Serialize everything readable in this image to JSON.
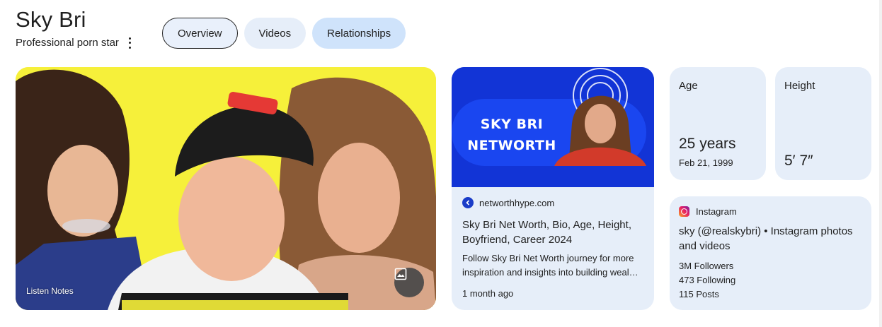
{
  "header": {
    "title": "Sky Bri",
    "subtitle": "Professional porn star"
  },
  "tabs": [
    {
      "label": "Overview"
    },
    {
      "label": "Videos"
    },
    {
      "label": "Relationships"
    }
  ],
  "main_image": {
    "watermark": "Listen Notes",
    "icon": "image-icon"
  },
  "article": {
    "thumb_text_line1": "SKY BRI",
    "thumb_text_line2": "NETWORTH",
    "source": "networthhype.com",
    "title": "Sky Bri Net Worth, Bio, Age, Height, Boyfriend, Career 2024",
    "snippet_line1": "Follow Sky Bri Net Worth journey for more",
    "snippet_line2": "inspiration and insights into building weal…",
    "date": "1 month ago"
  },
  "facts": {
    "age_label": "Age",
    "age_value": "25 years",
    "age_sub": "Feb 21, 1999",
    "height_label": "Height",
    "height_value": "5′ 7″"
  },
  "instagram": {
    "source": "Instagram",
    "title": "sky (@realskybri) • Instagram photos and videos",
    "followers": "3M Followers",
    "following": "473 Following",
    "posts": "115 Posts"
  },
  "colors": {
    "card_bg": "#e6eef9",
    "active_tab": "#cfe3fb",
    "thumb_blue": "#1234d6",
    "image_yellow": "#f6f03a"
  }
}
